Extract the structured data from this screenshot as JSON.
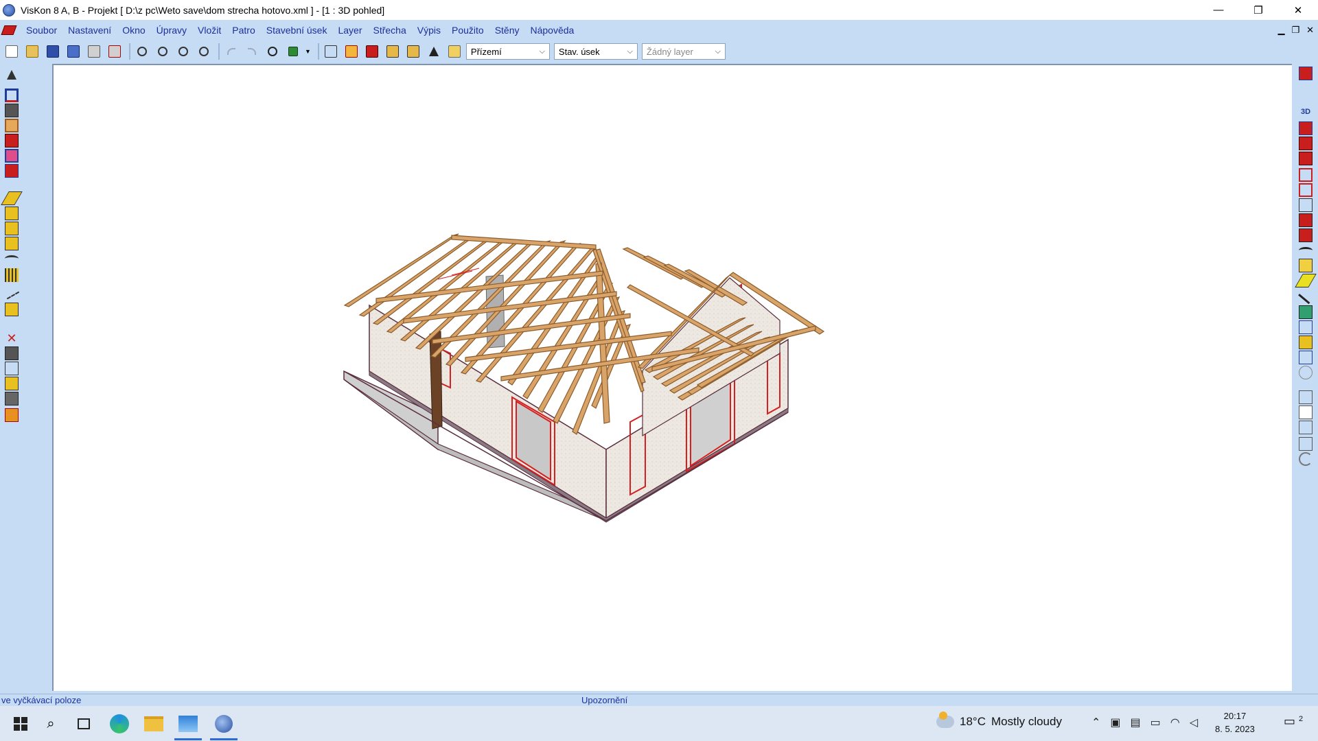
{
  "window": {
    "title": "VisKon 8 A, B - Projekt [ D:\\z pc\\Weto save\\dom strecha hotovo.xml ]  - [1 : 3D pohled]",
    "controls": [
      "—",
      "❐",
      "✕"
    ]
  },
  "menu": {
    "items": [
      "Soubor",
      "Nastavení",
      "Okno",
      "Úpravy",
      "Vložit",
      "Patro",
      "Stavební úsek",
      "Layer",
      "Střecha",
      "Výpis",
      "Použito",
      "Stěny",
      "Nápověda"
    ],
    "mdi_controls": [
      "▁",
      "❐",
      "✕"
    ]
  },
  "toolbar": {
    "floor_select": "Přízemí",
    "section_select": "Stav. úsek",
    "layer_select": "Žádný layer"
  },
  "status": {
    "left": "ve vyčkávací poloze",
    "middle": "Upozornění"
  },
  "taskbar": {
    "temperature": "18°C",
    "weather": "Mostly cloudy",
    "time": "20:17",
    "date": "8. 5. 2023",
    "notification_count": "2"
  },
  "colors": {
    "chrome": "#c6dcf5",
    "menu_text": "#1b2f9a",
    "timber": "#d9a46a",
    "wall": "#ece7e0",
    "frame_red": "#d42020"
  }
}
